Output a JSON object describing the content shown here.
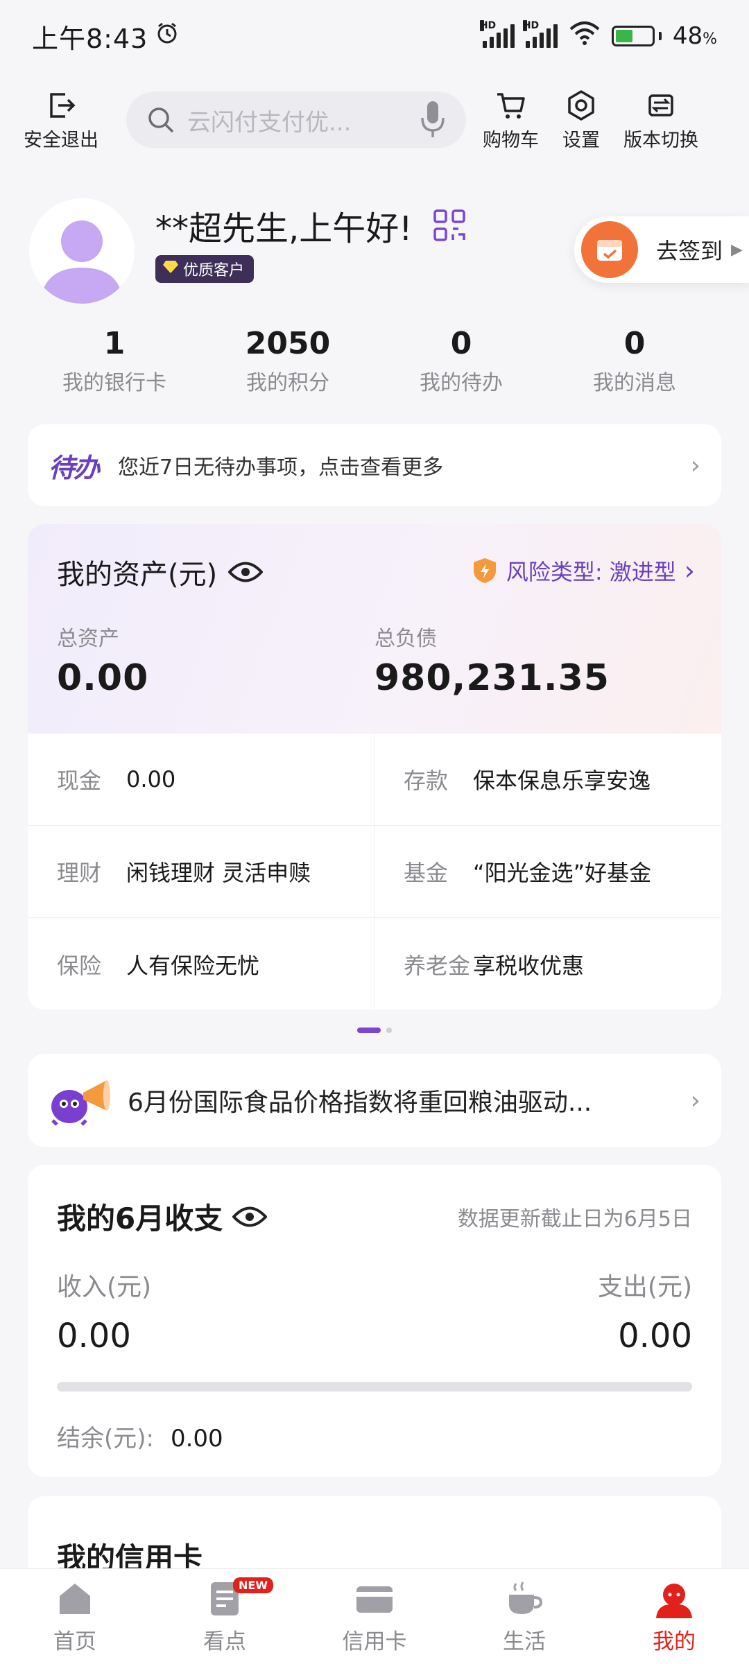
{
  "status_bar": {
    "time": "上午8:43",
    "battery_percent": "48",
    "battery_unit": "%",
    "signal_label": "HD"
  },
  "toolbar": {
    "logout_label": "安全退出",
    "search_placeholder": "云闪付支付优...",
    "cart_label": "购物车",
    "settings_label": "设置",
    "switch_version_label": "版本切换"
  },
  "profile": {
    "greeting": "**超先生,上午好!",
    "badge": "优质客户",
    "signin_label": "去签到"
  },
  "stats": [
    {
      "value": "1",
      "label": "我的银行卡"
    },
    {
      "value": "2050",
      "label": "我的积分"
    },
    {
      "value": "0",
      "label": "我的待办"
    },
    {
      "value": "0",
      "label": "我的消息"
    }
  ],
  "todo": {
    "tag": "待办",
    "text": "您近7日无待办事项，点击查看更多"
  },
  "assets": {
    "title": "我的资产(元)",
    "risk_label": "风险类型: 激进型",
    "total_assets_label": "总资产",
    "total_assets_value": "0.00",
    "total_liabilities_label": "总负债",
    "total_liabilities_value": "980,231.35",
    "items": [
      {
        "key": "现金",
        "value": "0.00"
      },
      {
        "key": "存款",
        "value": "保本保息乐享安逸"
      },
      {
        "key": "理财",
        "value": "闲钱理财 灵活申赎"
      },
      {
        "key": "基金",
        "value": "“阳光金选”好基金"
      },
      {
        "key": "保险",
        "value": "人有保险无忧"
      },
      {
        "key": "养老金",
        "value": "享税收优惠"
      }
    ]
  },
  "news": {
    "text": "6月份国际食品价格指数将重回粮油驱动..."
  },
  "income": {
    "title": "我的6月收支",
    "note": "数据更新截止日为6月5日",
    "income_label": "收入(元)",
    "income_value": "0.00",
    "expense_label": "支出(元)",
    "expense_value": "0.00",
    "balance_label": "结余(元):",
    "balance_value": "0.00"
  },
  "credit_card": {
    "title": "我的信用卡"
  },
  "nav": {
    "home": "首页",
    "view": "看点",
    "view_badge": "NEW",
    "credit": "信用卡",
    "life": "生活",
    "mine": "我的"
  },
  "colors": {
    "accent_purple": "#6a3fbf",
    "active_red": "#e2211c",
    "signin_orange": "#f2733a"
  }
}
